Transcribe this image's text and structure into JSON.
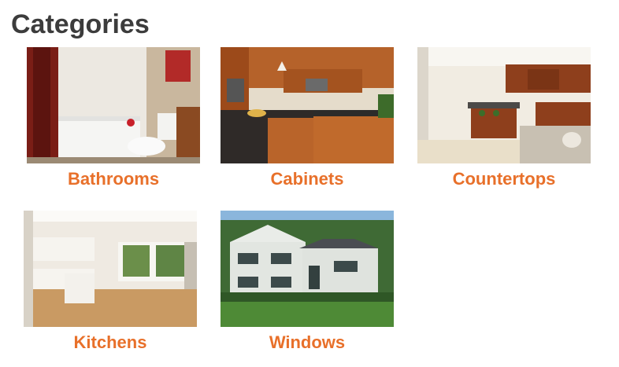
{
  "page": {
    "heading": "Categories"
  },
  "categories": [
    {
      "label": "Bathrooms"
    },
    {
      "label": "Cabinets"
    },
    {
      "label": "Countertops"
    },
    {
      "label": "Kitchens"
    },
    {
      "label": "Windows"
    }
  ],
  "colors": {
    "heading": "#3c3c3c",
    "accent": "#e8702a",
    "background": "#ffffff"
  }
}
